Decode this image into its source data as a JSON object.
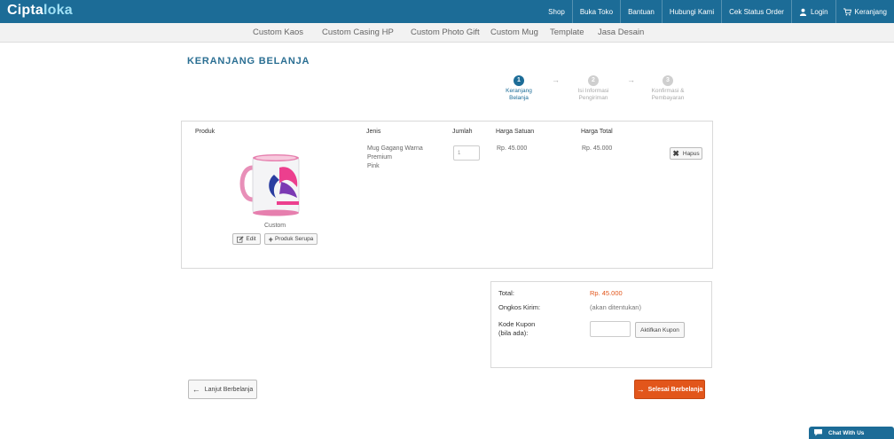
{
  "brand": {
    "part1": "Cipta",
    "part2": "loka"
  },
  "topnav": {
    "shop": "Shop",
    "buka_toko": "Buka Toko",
    "bantuan": "Bantuan",
    "hubungi": "Hubungi Kami",
    "cek_status": "Cek Status Order",
    "login": "Login",
    "keranjang": "Keranjang"
  },
  "subnav": [
    "Custom Kaos",
    "Custom Casing HP",
    "Custom Photo Gift",
    "Custom Mug",
    "Template",
    "Jasa Desain"
  ],
  "page_title": "KERANJANG BELANJA",
  "steps": [
    {
      "num": "1",
      "label1": "Keranjang",
      "label2": "Belanja"
    },
    {
      "num": "2",
      "label1": "Isi Informasi",
      "label2": "Pengiriman"
    },
    {
      "num": "3",
      "label1": "Konfirmasi &",
      "label2": "Pembayaran"
    }
  ],
  "table": {
    "headers": {
      "produk": "Produk",
      "jenis": "Jenis",
      "jumlah": "Jumlah",
      "harga_satuan": "Harga Satuan",
      "harga_total": "Harga Total"
    },
    "row": {
      "jenis_line1": "Mug Gagang Warna",
      "jenis_line2": "Premium",
      "jenis_line3": "Pink",
      "qty_placeholder": "1",
      "harga_satuan": "Rp. 45.000",
      "harga_total": "Rp. 45.000",
      "custom_label": "Custom",
      "edit_label": "Edit",
      "similar_label": "Produk Serupa",
      "remove_label": "Hapus"
    }
  },
  "summary": {
    "total_label": "Total:",
    "total_value": "Rp. 45.000",
    "shipping_label": "Ongkos Kirim:",
    "shipping_value": "(akan ditentukan)",
    "coupon_label1": "Kode Kupon",
    "coupon_label2": "(bila ada):",
    "coupon_button": "Aktifkan Kupon"
  },
  "actions": {
    "back": "Lanjut Berbelanja",
    "checkout": "Selesai Berbelanja"
  },
  "chat": "Chat With Us",
  "colors": {
    "primary": "#1c6c97",
    "accent": "#e2561b",
    "price": "#e2561b"
  }
}
